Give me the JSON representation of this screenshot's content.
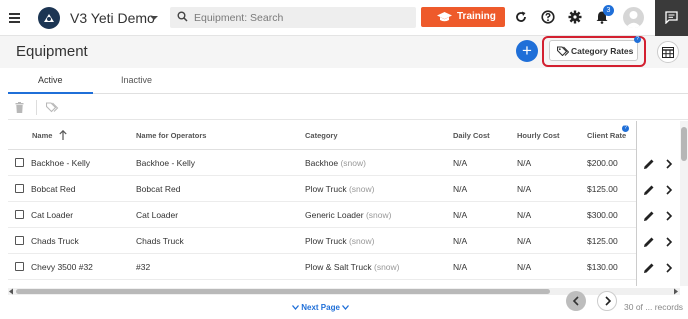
{
  "app": {
    "title": "V3 Yeti Demo"
  },
  "search": {
    "placeholder": "Equipment: Search"
  },
  "topbar": {
    "training_label": "Training",
    "notification_count": "3"
  },
  "page": {
    "title": "Equipment",
    "category_rates_label": "Category Rates",
    "category_rates_info": "?"
  },
  "tabs": [
    {
      "label": "Active"
    },
    {
      "label": "Inactive"
    }
  ],
  "table": {
    "columns": [
      "Name",
      "Name for Operators",
      "Category",
      "Daily Cost",
      "Hourly Cost",
      "Client Rate"
    ],
    "client_rate_info": "?",
    "rows": [
      {
        "name": "Backhoe - Kelly",
        "operator_name": "Backhoe - Kelly",
        "category": "Backhoe",
        "category_tag": "(snow)",
        "daily": "N/A",
        "hourly": "N/A",
        "client_rate": "$200.00"
      },
      {
        "name": "Bobcat Red",
        "operator_name": "Bobcat Red",
        "category": "Plow Truck",
        "category_tag": "(snow)",
        "daily": "N/A",
        "hourly": "N/A",
        "client_rate": "$125.00"
      },
      {
        "name": "Cat Loader",
        "operator_name": "Cat Loader",
        "category": "Generic Loader",
        "category_tag": "(snow)",
        "daily": "N/A",
        "hourly": "N/A",
        "client_rate": "$300.00"
      },
      {
        "name": "Chads Truck",
        "operator_name": "Chads Truck",
        "category": "Plow Truck",
        "category_tag": "(snow)",
        "daily": "N/A",
        "hourly": "N/A",
        "client_rate": "$125.00"
      },
      {
        "name": "Chevy 3500 #32",
        "operator_name": "#32",
        "category": "Plow & Salt Truck",
        "category_tag": "(snow)",
        "daily": "N/A",
        "hourly": "N/A",
        "client_rate": "$130.00"
      }
    ]
  },
  "pagination": {
    "next_label": "Next Page",
    "records_label": "30 of ... records"
  },
  "colors": {
    "accent": "#1f6fd8",
    "training": "#ee5a2b",
    "highlight": "#d32030"
  }
}
